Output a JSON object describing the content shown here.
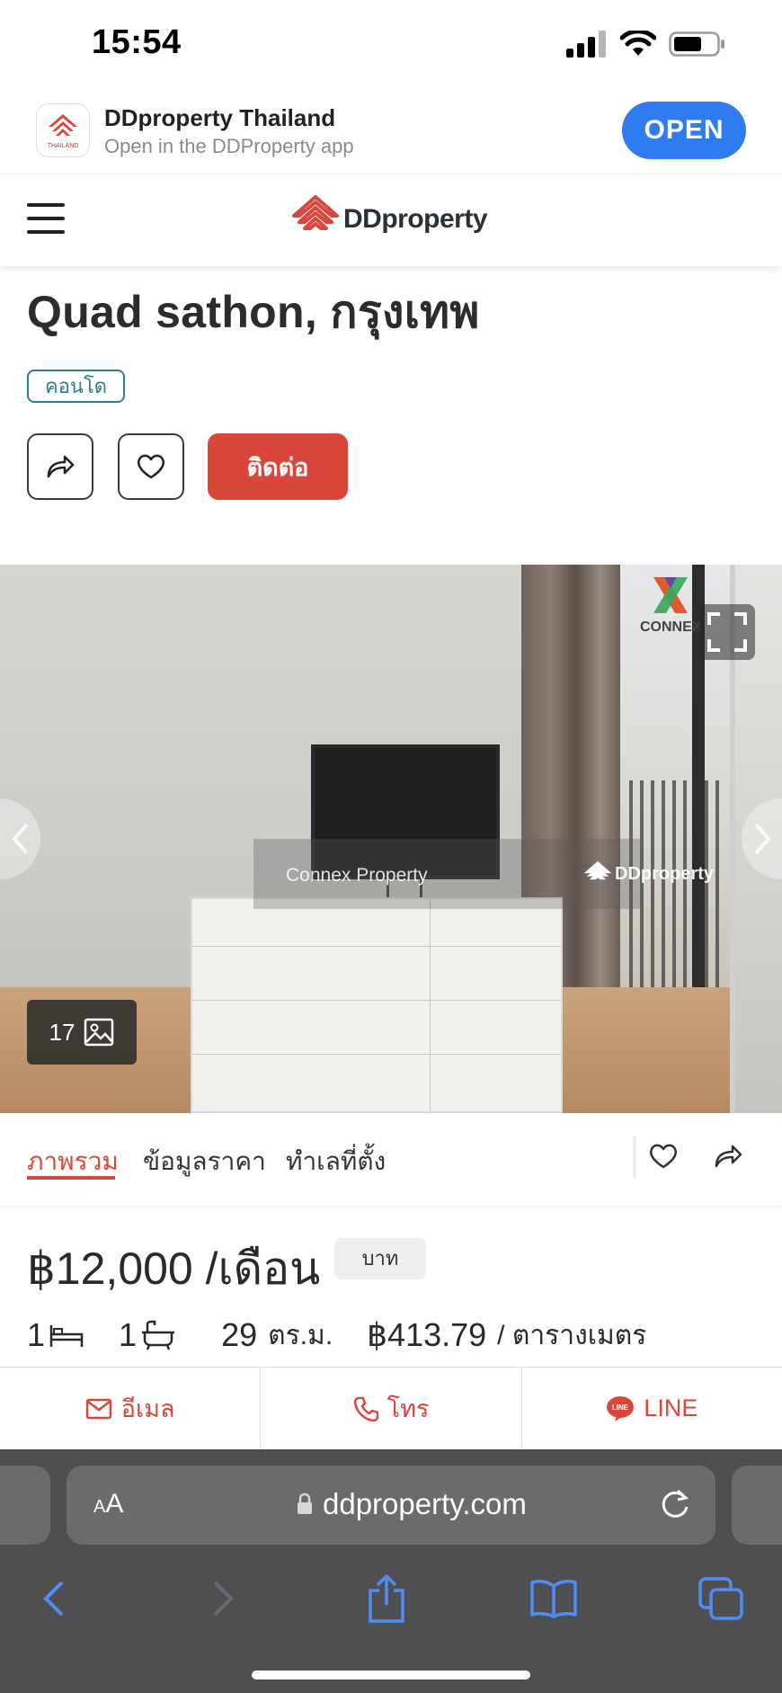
{
  "status_bar": {
    "time": "15:54"
  },
  "app_banner": {
    "title": "DDproperty Thailand",
    "subtitle": "Open in the DDProperty app",
    "open_label": "OPEN",
    "icon_caption": "THAILAND"
  },
  "header": {
    "logo_text": "DDproperty"
  },
  "listing": {
    "title": "Quad sathon, กรุงเทพ",
    "type_badge": "คอนโด",
    "contact_label": "ติดต่อ"
  },
  "gallery": {
    "photo_count": "17",
    "watermark_left": "Connex Property",
    "watermark_right": "DDproperty",
    "agency_logo": "CONNEX"
  },
  "tabs": [
    {
      "label": "ภาพรวม",
      "active": true
    },
    {
      "label": "ข้อมูลราคา",
      "active": false
    },
    {
      "label": "ทำเลที่ตั้ง",
      "active": false
    }
  ],
  "price": {
    "amount": "฿12,000 /เดือน",
    "currency_badge": "บาท"
  },
  "features": {
    "bedrooms": "1",
    "bathrooms": "1",
    "area": "29",
    "area_unit": "ตร.ม.",
    "price_per_sqm": "฿413.79",
    "price_per_sqm_unit": "/ ตารางเมตร"
  },
  "contact_bar": {
    "email_label": "อีเมล",
    "call_label": "โทร",
    "line_label": "LINE"
  },
  "browser": {
    "aa_small": "A",
    "aa_large": "A",
    "url": "ddproperty.com"
  },
  "colors": {
    "brand_red": "#d9473a",
    "badge_teal": "#2c7f86",
    "open_blue": "#2f7bf0",
    "browser_chrome": "#4f4f52"
  },
  "icons": [
    "signal-icon",
    "wifi-icon",
    "battery-icon",
    "menu-icon",
    "share-icon",
    "heart-icon",
    "fullscreen-icon",
    "image-icon",
    "bed-icon",
    "bath-icon",
    "mail-icon",
    "phone-icon",
    "line-icon",
    "lock-icon",
    "reload-icon",
    "back-icon",
    "forward-icon",
    "share-sheet-icon",
    "bookmarks-icon",
    "tabs-icon"
  ]
}
